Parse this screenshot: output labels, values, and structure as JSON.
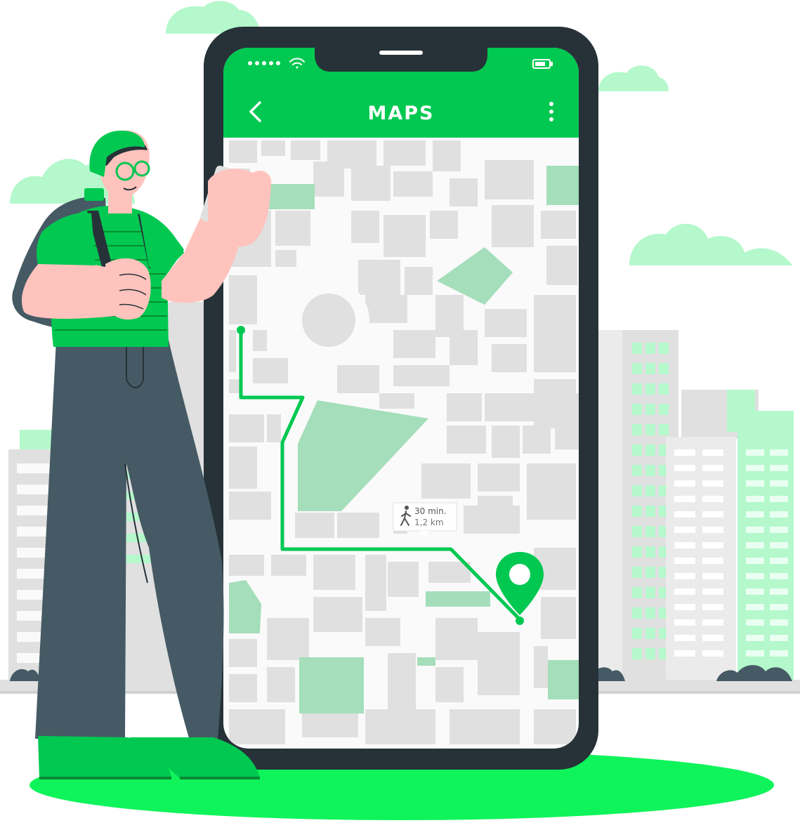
{
  "app": {
    "title": "MAPS",
    "back_icon": "chevron-left-icon",
    "menu_icon": "more-vertical-icon"
  },
  "status_bar": {
    "signal_icon": "signal-dots-icon",
    "wifi_icon": "wifi-icon",
    "battery_icon": "battery-icon"
  },
  "route_callout": {
    "duration": "30 min.",
    "distance": "1,2 km",
    "mode_icon": "walking-person-icon"
  },
  "map": {
    "destination_icon": "location-pin-icon",
    "start_icon": "route-start-dot-icon"
  },
  "colors": {
    "brand_green": "#00C851",
    "dark_green": "#0a8a33",
    "floor_green": "#0EF45A",
    "phone_frame": "#263238",
    "park_green": "#A5DEBA",
    "light_green": "#B4F8CC",
    "block_gray": "#E0E0E0",
    "road_white": "#FAFAFA",
    "skin": "#FFC3BD",
    "pants": "#455A64"
  }
}
